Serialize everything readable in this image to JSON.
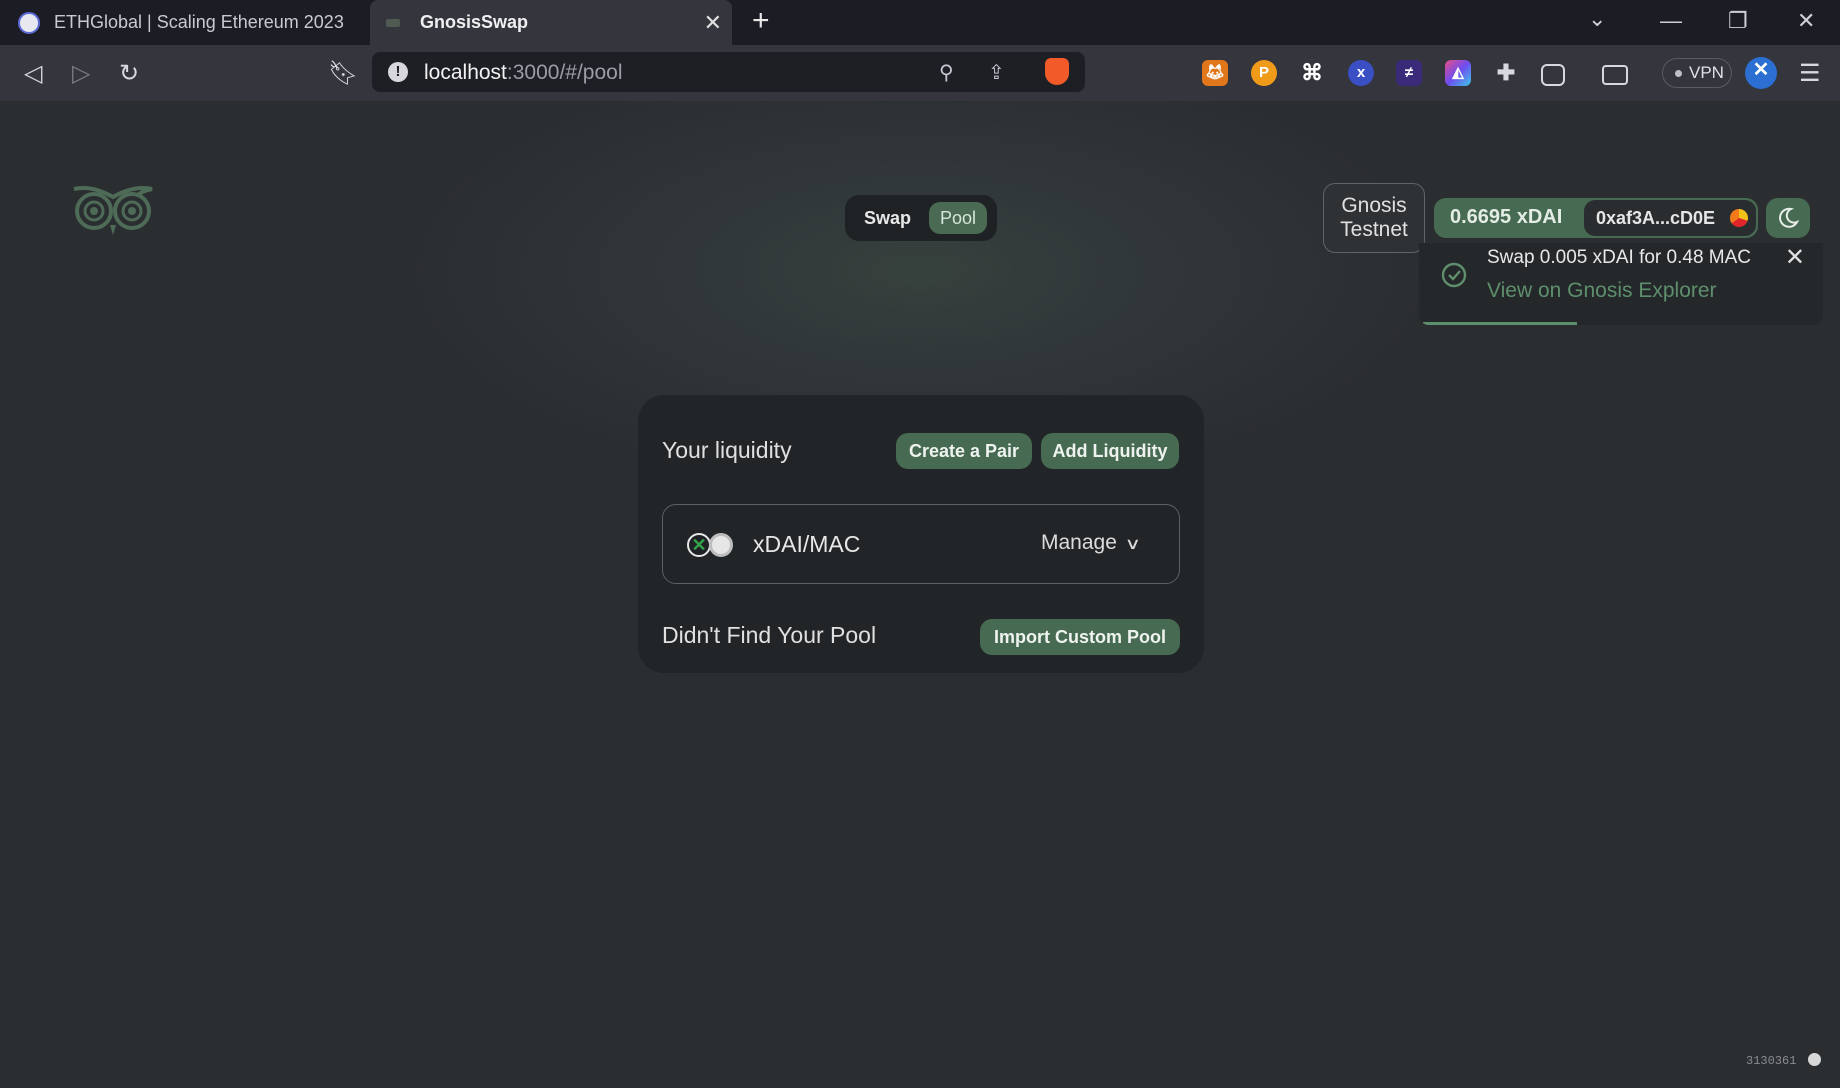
{
  "browser": {
    "tabs": [
      {
        "title": "ETHGlobal | Scaling Ethereum 2023",
        "active": false
      },
      {
        "title": "GnosisSwap",
        "active": true
      }
    ],
    "url_host": "localhost",
    "url_path": ":3000/#/pool",
    "vpn_label": "VPN",
    "extensions": [
      "metamask-icon",
      "p-coin-icon",
      "command-icon",
      "x-circle-icon",
      "purple-ext-icon",
      "gradient-ext-icon",
      "puzzle-icon"
    ]
  },
  "app": {
    "nav": {
      "swap": "Swap",
      "pool": "Pool"
    },
    "network": "Gnosis Testnet",
    "balance": "0.6695 xDAI",
    "address": "0xaf3A...cD0E",
    "toast": {
      "message": "Swap 0.005 xDAI for 0.48 MAC",
      "link": "View on Gnosis Explorer"
    },
    "liquidity": {
      "title": "Your liquidity",
      "create_pair": "Create a Pair",
      "add_liquidity": "Add Liquidity",
      "pairs": [
        {
          "label": "xDAI/MAC",
          "manage": "Manage"
        }
      ],
      "not_found": "Didn't Find Your Pool",
      "import_pool": "Import Custom Pool"
    },
    "footer_block": "3130361"
  },
  "colors": {
    "accent": "#476a52",
    "link": "#5e8f6c",
    "page_bg": "#2b2e30",
    "card_bg": "#222527"
  }
}
